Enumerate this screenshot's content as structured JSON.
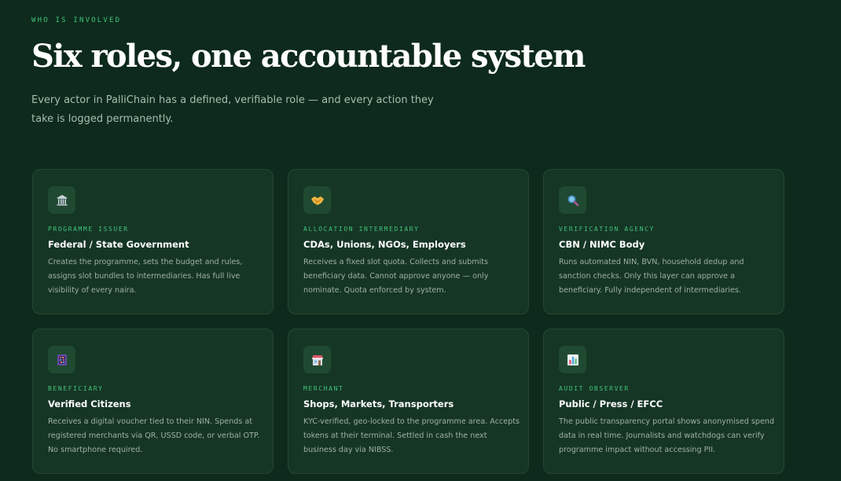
{
  "header": {
    "eyebrow": "WHO IS INVOLVED",
    "title": "Six roles, one accountable system",
    "lede": "Every actor in PalliChain has a defined, verifiable role — and every action they take is logged permanently."
  },
  "colors": {
    "background": "#0d2a1c",
    "card": "#163625",
    "accent": "#3fc47a"
  },
  "roles": [
    {
      "icon": "classical-building-icon",
      "tag": "PROGRAMME ISSUER",
      "name": "Federal / State Government",
      "description": "Creates the programme, sets the budget and rules, assigns slot bundles to intermediaries. Has full live visibility of every naira."
    },
    {
      "icon": "handshake-icon",
      "tag": "ALLOCATION INTERMEDIARY",
      "name": "CDAs, Unions, NGOs, Employers",
      "description": "Receives a fixed slot quota. Collects and submits beneficiary data. Cannot approve anyone — only nominate. Quota enforced by system."
    },
    {
      "icon": "magnifying-glass-icon",
      "tag": "VERIFICATION AGENCY",
      "name": "CBN / NIMC Body",
      "description": "Runs automated NIN, BVN, household dedup and sanction checks. Only this layer can approve a beneficiary. Fully independent of intermediaries."
    },
    {
      "icon": "abacus-icon",
      "tag": "BENEFICIARY",
      "name": "Verified Citizens",
      "description": "Receives a digital voucher tied to their NIN. Spends at registered merchants via QR, USSD code, or verbal OTP. No smartphone required."
    },
    {
      "icon": "storefront-icon",
      "tag": "MERCHANT",
      "name": "Shops, Markets, Transporters",
      "description": "KYC-verified, geo-locked to the programme area. Accepts tokens at their terminal. Settled in cash the next business day via NIBSS."
    },
    {
      "icon": "bar-chart-icon",
      "tag": "AUDIT OBSERVER",
      "name": "Public / Press / EFCC",
      "description": "The public transparency portal shows anonymised spend data in real time. Journalists and watchdogs can verify programme impact without accessing PII."
    }
  ]
}
